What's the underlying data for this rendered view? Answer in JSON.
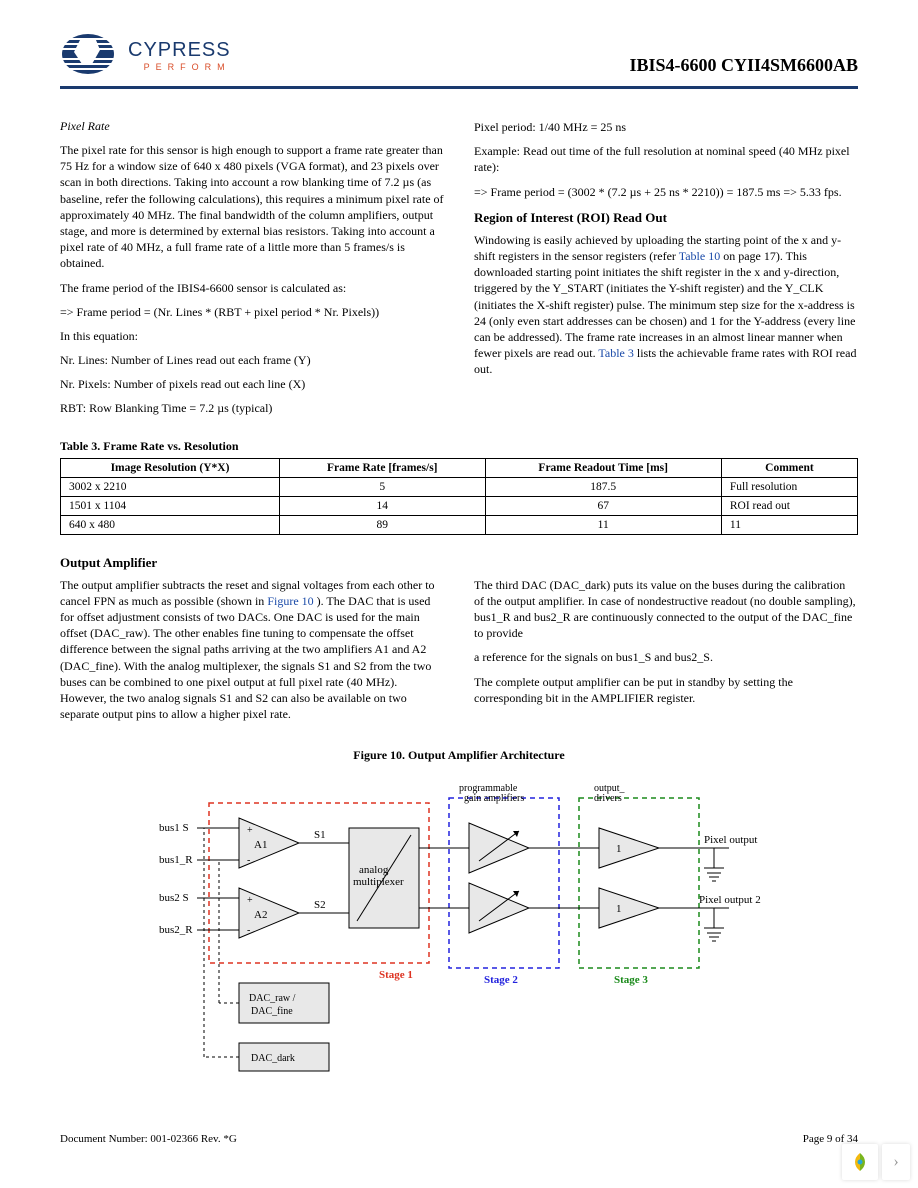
{
  "header": {
    "logo_main": "CYPRESS",
    "logo_sub": "PERFORM",
    "doc_title": "IBIS4-6600 CYII4SM6600AB"
  },
  "left": {
    "pixel_rate_title": "Pixel Rate",
    "pixel_rate_p1": "The pixel rate for this sensor is high enough to support a frame rate greater than 75 Hz for a window size of 640 x 480 pixels (VGA format), and 23 pixels over scan in both directions. Taking into account a row blanking time of 7.2 µs (as baseline, refer the following calculations), this requires a minimum pixel rate of approximately 40 MHz. The final bandwidth of the column amplifiers, output stage, and more is determined by external bias resistors. Taking into account a pixel rate of 40 MHz, a full frame rate of a little more than 5 frames/s is obtained.",
    "pixel_rate_p2": "The frame period of the IBIS4-6600 sensor is calculated as:",
    "pixel_rate_eq": " => Frame period = (Nr. Lines * (RBT + pixel period * Nr. Pixels))",
    "pixel_rate_p3": "In this equation:",
    "pixel_rate_p4": "Nr. Lines: Number of Lines read out each frame (Y)",
    "pixel_rate_p5": "Nr. Pixels: Number of pixels read out each line (X)",
    "pixel_rate_p6": "RBT: Row Blanking Time = 7.2 µs (typical)"
  },
  "right": {
    "r1": "Pixel period: 1/40 MHz = 25 ns",
    "r2": "Example: Read out time of the full resolution at nominal speed (40 MHz pixel rate):",
    "r3": " => Frame period = (3002 * (7.2 µs + 25 ns * 2210)) = 187.5 ms => 5.33 fps.",
    "roi_title": "Region of Interest (ROI) Read Out",
    "roi_p1a": "Windowing is easily achieved by uploading the starting point of the x and y-shift registers in the sensor registers (refer ",
    "roi_link1": "Table 10",
    "roi_p1b": " on page 17). This downloaded starting point initiates the shift register in the x and y-direction, triggered by the Y_START (initiates the Y-shift register) and the Y_CLK (initiates the X-shift register) pulse. The minimum step size for the x-address is 24 (only even start addresses can be chosen) and 1 for the Y-address (every line can be addressed). The frame rate increases in an almost linear manner when fewer pixels are read out. ",
    "roi_link2": "Table 3",
    "roi_p1c": " lists the achievable frame rates with ROI read out."
  },
  "table3": {
    "caption": "Table 3. Frame Rate vs. Resolution",
    "headers": [
      "Image Resolution (Y*X)",
      "Frame Rate [frames/s]",
      "Frame Readout Time [ms]",
      "Comment"
    ],
    "rows": [
      [
        "3002 x 2210",
        "5",
        "187.5",
        "Full resolution"
      ],
      [
        "1501 x 1104",
        "14",
        "67",
        "ROI read out"
      ],
      [
        "640 x 480",
        "89",
        "11",
        "11"
      ]
    ]
  },
  "outamp": {
    "title": "Output Amplifier",
    "left_p1a": "The output amplifier subtracts the reset and signal voltages from each other to cancel FPN as much as possible (shown in ",
    "left_link": "Figure 10",
    "left_p1b": "). The DAC that is used for offset adjustment consists of two DACs. One DAC is used for the main offset (DAC_raw). The other enables fine tuning to compensate the offset difference between the signal paths arriving at the two amplifiers A1 and A2 (DAC_fine). With the analog multiplexer, the signals S1 and S2 from the two buses can be combined to one pixel output at full pixel rate (40 MHz). However, the two analog signals S1 and S2 can also be available on two separate output pins to allow a higher pixel rate.",
    "right_p1": "The third DAC (DAC_dark) puts its value on the buses during the calibration of the output amplifier. In case of nondestructive readout (no double sampling), bus1_R and bus2_R are continuously connected to the output of the DAC_fine to provide",
    "right_p2": "a reference for the signals on bus1_S and bus2_S.",
    "right_p3": "The complete output amplifier can be put in standby by setting the corresponding bit in the AMPLIFIER register."
  },
  "figure": {
    "caption": "Figure 10.  Output Amplifier Architecture",
    "labels": {
      "bus1s": "bus1 S",
      "bus1r": "bus1_R",
      "bus2s": "bus2 S",
      "bus2r": "bus2_R",
      "a1": "A1",
      "a2": "A2",
      "s1": "S1",
      "s2": "S2",
      "mux": "analog multiplexer",
      "dac_rawfine": "DAC_raw / DAC_fine",
      "dac_dark": "DAC_dark",
      "pga": "programmable gain amplifiers",
      "outputdrivers": "output_\ndrivers",
      "pixout": "Pixel output",
      "pixout2": "Pixel output 2",
      "stage1": "Stage 1",
      "stage2": "Stage 2",
      "stage3": "Stage 3",
      "one": "1"
    }
  },
  "footer": {
    "left": "Document Number: 001-02366  Rev. *G",
    "right": "Page 9 of 34"
  }
}
